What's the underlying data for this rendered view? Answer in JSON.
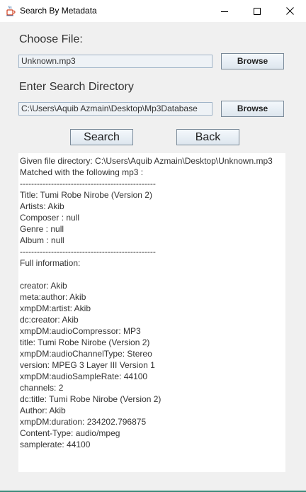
{
  "window": {
    "title": "Search By Metadata",
    "icon": "java-coffee-cup-icon",
    "controls": [
      "minimize-icon",
      "maximize-icon",
      "close-icon"
    ]
  },
  "file_section": {
    "label": "Choose File:",
    "value": "Unknown.mp3",
    "browse_label": "Browse"
  },
  "directory_section": {
    "label": "Enter Search Directory",
    "value": "C:\\Users\\Aquib Azmain\\Desktop\\Mp3Database",
    "browse_label": "Browse"
  },
  "actions": {
    "search_label": "Search",
    "back_label": "Back"
  },
  "results": {
    "lines": [
      "Given file directory: C:\\Users\\Aquib Azmain\\Desktop\\Unknown.mp3",
      "Matched with the following mp3 :",
      "------------------------------------------------",
      "Title: Tumi Robe Nirobe (Version 2)",
      "Artists: Akib",
      "Composer : null",
      "Genre : null",
      "Album : null",
      "------------------------------------------------",
      "Full information:",
      "",
      "creator: Akib",
      "meta:author: Akib",
      "xmpDM:artist: Akib",
      "dc:creator: Akib",
      "xmpDM:audioCompressor: MP3",
      "title: Tumi Robe Nirobe (Version 2)",
      "xmpDM:audioChannelType: Stereo",
      "version: MPEG 3 Layer III Version 1",
      "xmpDM:audioSampleRate: 44100",
      "channels: 2",
      "dc:title: Tumi Robe Nirobe (Version 2)",
      "Author: Akib",
      "xmpDM:duration: 234202.796875",
      "Content-Type: audio/mpeg",
      "samplerate: 44100"
    ]
  }
}
